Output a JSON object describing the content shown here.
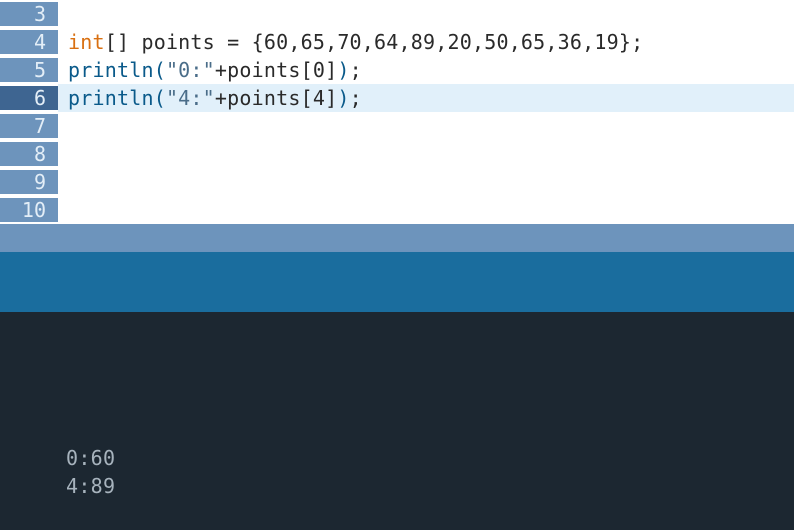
{
  "editor": {
    "lines": [
      {
        "num": "3",
        "active": false,
        "highlighted": false,
        "tokens": []
      },
      {
        "num": "4",
        "active": false,
        "highlighted": false,
        "tokens": [
          {
            "cls": "tok-type",
            "text": "int"
          },
          {
            "cls": "tok-plain",
            "text": "[] points = {60,65,70,64,89,20,50,65,36,19};"
          }
        ]
      },
      {
        "num": "5",
        "active": false,
        "highlighted": false,
        "tokens": [
          {
            "cls": "tok-func",
            "text": "println"
          },
          {
            "cls": "tok-paren",
            "text": "("
          },
          {
            "cls": "tok-str",
            "text": "\"0:\""
          },
          {
            "cls": "tok-plain",
            "text": "+points[0]"
          },
          {
            "cls": "tok-paren",
            "text": ")"
          },
          {
            "cls": "tok-plain",
            "text": ";"
          }
        ]
      },
      {
        "num": "6",
        "active": true,
        "highlighted": true,
        "tokens": [
          {
            "cls": "tok-func",
            "text": "println"
          },
          {
            "cls": "tok-paren",
            "text": "("
          },
          {
            "cls": "tok-str",
            "text": "\"4:\""
          },
          {
            "cls": "tok-plain",
            "text": "+points[4]"
          },
          {
            "cls": "tok-paren",
            "text": ")"
          },
          {
            "cls": "tok-plain",
            "text": ";"
          }
        ]
      },
      {
        "num": "7",
        "active": false,
        "highlighted": false,
        "tokens": []
      },
      {
        "num": "8",
        "active": false,
        "highlighted": false,
        "tokens": []
      },
      {
        "num": "9",
        "active": false,
        "highlighted": false,
        "tokens": []
      },
      {
        "num": "10",
        "active": false,
        "highlighted": false,
        "tokens": []
      }
    ]
  },
  "console": {
    "output": [
      "0:60",
      "4:89"
    ]
  }
}
